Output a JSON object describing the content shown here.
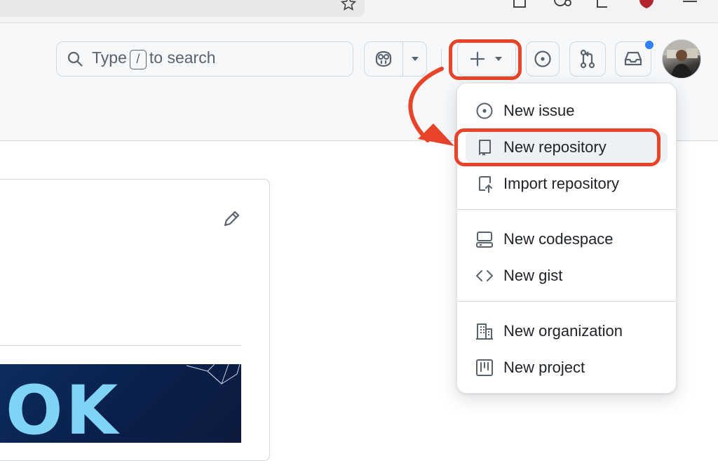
{
  "header": {
    "search_placeholder_before": "Type",
    "search_key": "/",
    "search_placeholder_after": "to search"
  },
  "create_menu": {
    "items": [
      {
        "label": "New issue"
      },
      {
        "label": "New repository"
      },
      {
        "label": "Import repository"
      },
      {
        "label": "New codespace"
      },
      {
        "label": "New gist"
      },
      {
        "label": "New organization"
      },
      {
        "label": "New project"
      }
    ]
  },
  "content": {
    "banner_text": "OK"
  },
  "colors": {
    "annotation": "#e8442a",
    "notification_dot": "#2f81f7"
  }
}
